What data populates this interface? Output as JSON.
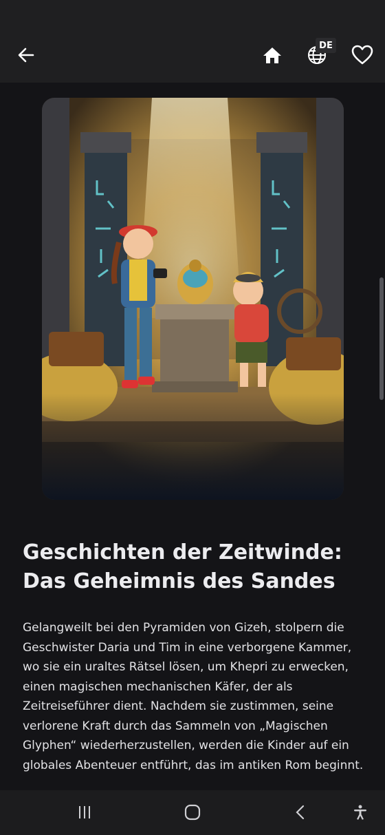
{
  "appbar": {
    "language_badge": "DE",
    "icons": [
      "arrow-left-icon",
      "home-icon",
      "globe-icon",
      "heart-outline-icon"
    ]
  },
  "book": {
    "title": "Geschichten der Zeitwinde: Das Geheimnis des Sandes",
    "description": "Gelangweilt bei den Pyramiden von Gizeh, stolpern die Geschwister Daria und Tim in eine verborgene Kammer, wo sie ein uraltes Rätsel lösen, um Khepri zu erwecken, einen magischen mechanischen Käfer, der als Zeitreiseführer dient. Nachdem sie zustimmen, seine verlorene Kraft durch das Sammeln von „Magischen Glyphen“ wiederherzustellen, werden die Kinder auf ein globales Abenteuer entführt, das im antiken Rom beginnt."
  },
  "navbar": {
    "icons": [
      "recents-icon",
      "home-circle-icon",
      "back-chevron-icon",
      "accessibility-icon"
    ]
  },
  "colors": {
    "background": "#141417",
    "appbar": "#1f1f21",
    "navbar": "#1c1c1e",
    "text": "#ececef"
  }
}
